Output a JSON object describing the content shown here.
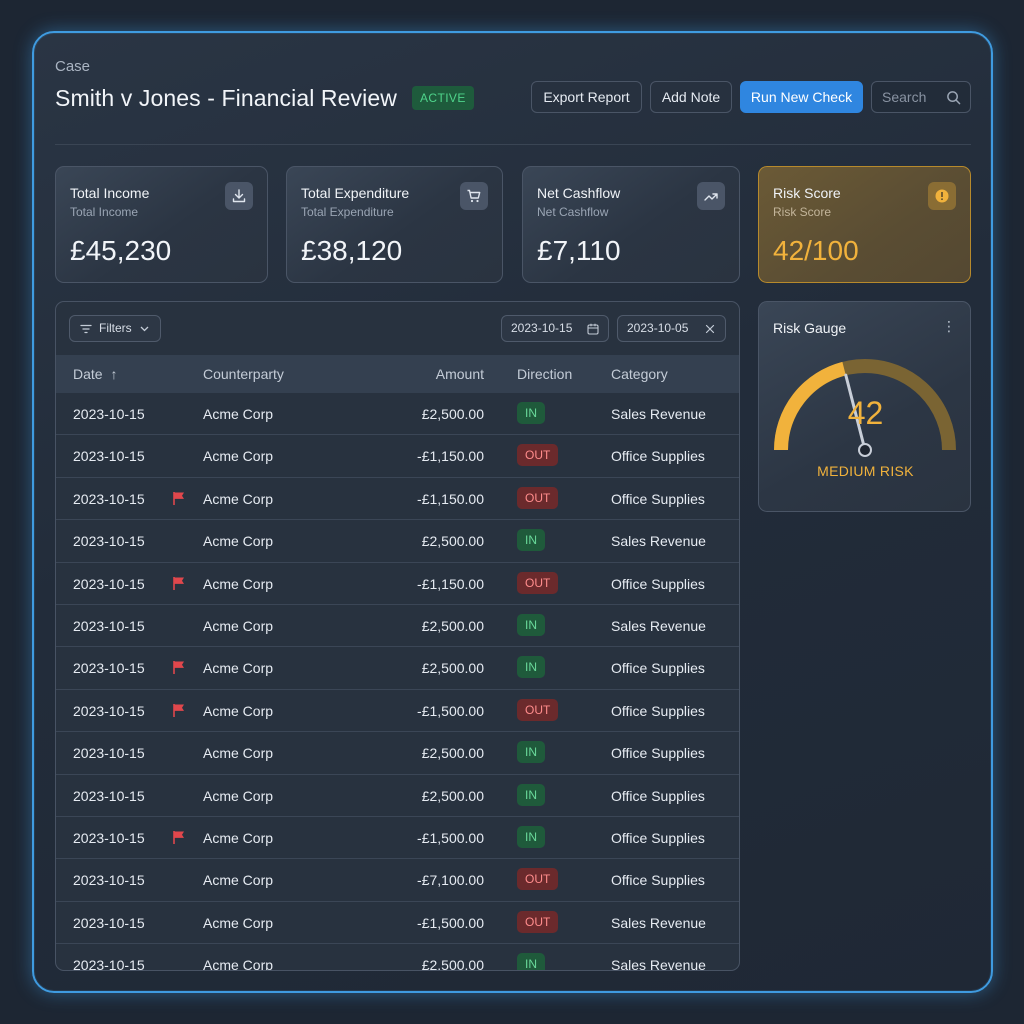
{
  "header": {
    "case_label": "Case",
    "title": "Smith v Jones - Financial Review",
    "status": "ACTIVE",
    "buttons": {
      "export": "Export Report",
      "add_note": "Add Note",
      "run_check": "Run New Check"
    },
    "search_placeholder": "Search"
  },
  "cards": [
    {
      "title": "Total Income",
      "subtitle": "Total Income",
      "value": "£45,230",
      "icon": "download-icon"
    },
    {
      "title": "Total Expenditure",
      "subtitle": "Total Expenditure",
      "value": "£38,120",
      "icon": "cart-icon"
    },
    {
      "title": "Net Cashflow",
      "subtitle": "Net Cashflow",
      "value": "£7,110",
      "icon": "trend-up-icon"
    },
    {
      "title": "Risk Score",
      "subtitle": "Risk Score",
      "value": "42/100",
      "icon": "alert-icon"
    }
  ],
  "table": {
    "filters_label": "Filters",
    "date_from": "2023-10-15",
    "date_to": "2023-10-05",
    "columns": {
      "date": "Date",
      "counterparty": "Counterparty",
      "amount": "Amount",
      "direction": "Direction",
      "category": "Category"
    },
    "sort_indicator": "↑",
    "rows": [
      {
        "date": "2023-10-15",
        "flag": false,
        "counterparty": "Acme Corp",
        "amount": "£2,500.00",
        "direction": "IN",
        "category": "Sales Revenue"
      },
      {
        "date": "2023-10-15",
        "flag": false,
        "counterparty": "Acme Corp",
        "amount": "-£1,150.00",
        "direction": "OUT",
        "category": "Office Supplies"
      },
      {
        "date": "2023-10-15",
        "flag": true,
        "counterparty": "Acme Corp",
        "amount": "-£1,150.00",
        "direction": "OUT",
        "category": "Office Supplies"
      },
      {
        "date": "2023-10-15",
        "flag": false,
        "counterparty": "Acme Corp",
        "amount": "£2,500.00",
        "direction": "IN",
        "category": "Sales Revenue"
      },
      {
        "date": "2023-10-15",
        "flag": true,
        "counterparty": "Acme Corp",
        "amount": "-£1,150.00",
        "direction": "OUT",
        "category": "Office Supplies"
      },
      {
        "date": "2023-10-15",
        "flag": false,
        "counterparty": "Acme Corp",
        "amount": "£2,500.00",
        "direction": "IN",
        "category": "Sales Revenue"
      },
      {
        "date": "2023-10-15",
        "flag": true,
        "counterparty": "Acme Corp",
        "amount": "£2,500.00",
        "direction": "IN",
        "category": "Office Supplies"
      },
      {
        "date": "2023-10-15",
        "flag": true,
        "counterparty": "Acme Corp",
        "amount": "-£1,500.00",
        "direction": "OUT",
        "category": "Office Supplies"
      },
      {
        "date": "2023-10-15",
        "flag": false,
        "counterparty": "Acme Corp",
        "amount": "£2,500.00",
        "direction": "IN",
        "category": "Office Supplies"
      },
      {
        "date": "2023-10-15",
        "flag": false,
        "counterparty": "Acme Corp",
        "amount": "£2,500.00",
        "direction": "IN",
        "category": "Office Supplies"
      },
      {
        "date": "2023-10-15",
        "flag": true,
        "counterparty": "Acme Corp",
        "amount": "-£1,500.00",
        "direction": "IN",
        "category": "Office Supplies"
      },
      {
        "date": "2023-10-15",
        "flag": false,
        "counterparty": "Acme Corp",
        "amount": "-£7,100.00",
        "direction": "OUT",
        "category": "Office Supplies"
      },
      {
        "date": "2023-10-15",
        "flag": false,
        "counterparty": "Acme Corp",
        "amount": "-£1,500.00",
        "direction": "OUT",
        "category": "Sales Revenue"
      },
      {
        "date": "2023-10-15",
        "flag": false,
        "counterparty": "Acme Corp",
        "amount": "£2,500.00",
        "direction": "IN",
        "category": "Sales Revenue"
      }
    ]
  },
  "gauge": {
    "title": "Risk Gauge",
    "value": "42",
    "level_label": "MEDIUM RISK",
    "fraction": 0.42
  },
  "colors": {
    "accent": "#2f86e0",
    "risk": "#f1b23c",
    "in": "#69d99a",
    "out": "#ff8c8c",
    "flag": "#e0474c"
  }
}
